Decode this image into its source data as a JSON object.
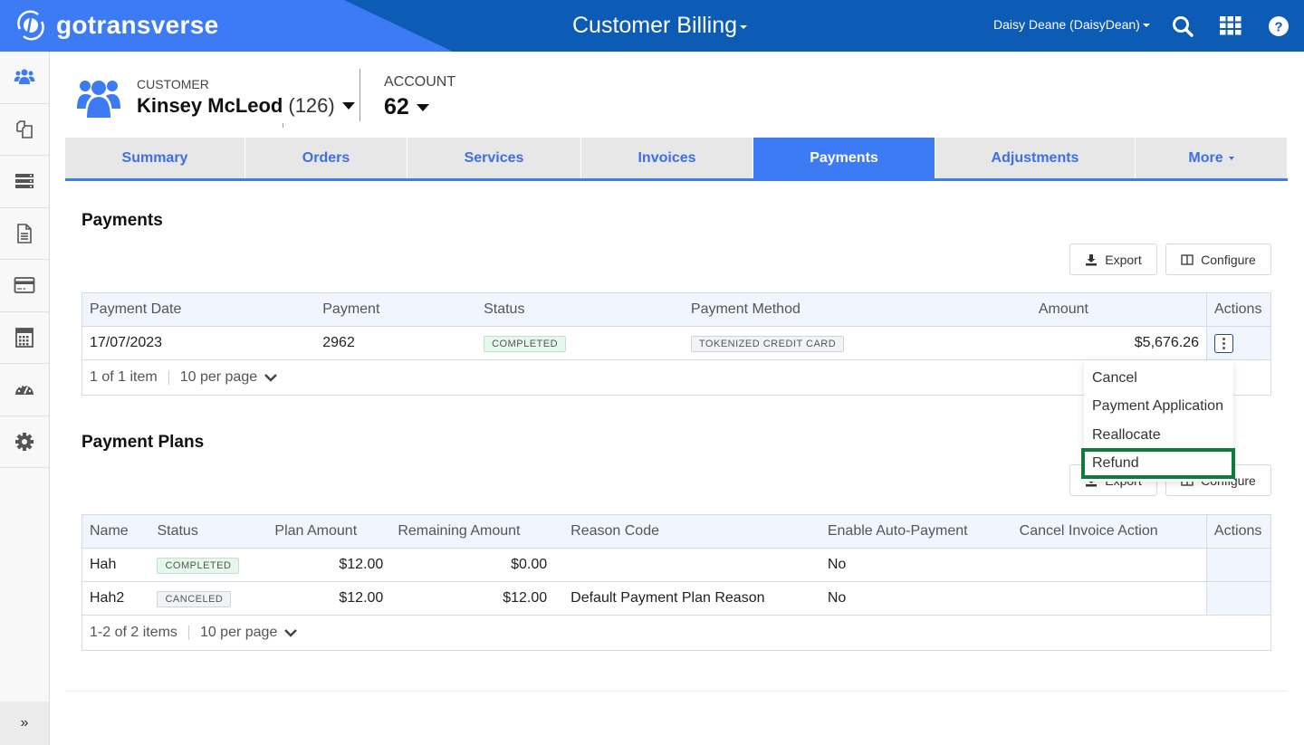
{
  "topbar": {
    "brand": "gotransverse",
    "app_title": "Customer Billing",
    "user": "Daisy Deane (DaisyDean)",
    "icons": [
      "search-icon",
      "apps-grid-icon",
      "help-icon"
    ]
  },
  "sidebar": {
    "items": [
      {
        "name": "customers",
        "icon": "users-icon",
        "active": true
      },
      {
        "name": "orders",
        "icon": "copy-icon"
      },
      {
        "name": "services",
        "icon": "server-icon"
      },
      {
        "name": "invoices",
        "icon": "document-icon"
      },
      {
        "name": "payments",
        "icon": "credit-card-icon"
      },
      {
        "name": "calculator",
        "icon": "calculator-icon"
      },
      {
        "name": "dashboard",
        "icon": "gauge-icon"
      },
      {
        "name": "settings",
        "icon": "gear-icon"
      }
    ],
    "expand_label": "»"
  },
  "header": {
    "customer_label": "CUSTOMER",
    "customer_name": "Kinsey McLeod",
    "customer_id": "(126)",
    "account_label": "ACCOUNT",
    "account_number": "62"
  },
  "tabs": [
    {
      "label": "Summary"
    },
    {
      "label": "Orders"
    },
    {
      "label": "Services"
    },
    {
      "label": "Invoices"
    },
    {
      "label": "Payments",
      "active": true
    },
    {
      "label": "Adjustments"
    },
    {
      "label": "More"
    }
  ],
  "payments": {
    "title": "Payments",
    "export_label": "Export",
    "configure_label": "Configure",
    "columns": [
      "Payment Date",
      "Payment",
      "Status",
      "Payment Method",
      "Amount",
      "Actions"
    ],
    "rows": [
      {
        "date": "17/07/2023",
        "payment": "2962",
        "status": "COMPLETED",
        "method": "TOKENIZED CREDIT CARD",
        "amount": "$5,676.26"
      }
    ],
    "pager": {
      "summary": "1 of 1 item",
      "per_page": "10 per page"
    }
  },
  "actions_menu": {
    "items": [
      "Cancel",
      "Payment Application",
      "Reallocate",
      "Refund"
    ],
    "highlighted": "Refund"
  },
  "payment_plans": {
    "title": "Payment Plans",
    "export_label": "Export",
    "configure_label": "Configure",
    "columns": [
      "Name",
      "Status",
      "Plan Amount",
      "Remaining Amount",
      "Reason Code",
      "Enable Auto-Payment",
      "Cancel Invoice Action",
      "Actions"
    ],
    "rows": [
      {
        "name": "Hah",
        "status": "COMPLETED",
        "plan_amount": "$12.00",
        "remaining": "$0.00",
        "reason": "",
        "auto_pay": "No",
        "cancel_action": ""
      },
      {
        "name": "Hah2",
        "status": "CANCELED",
        "plan_amount": "$12.00",
        "remaining": "$12.00",
        "reason": "Default Payment Plan Reason",
        "auto_pay": "No",
        "cancel_action": ""
      }
    ],
    "pager": {
      "summary": "1-2 of 2 items",
      "per_page": "10 per page"
    }
  },
  "colors": {
    "brand_blue": "#3d7bf4",
    "topbar_dark": "#0c5bb5",
    "highlight_green": "#0f7a3c"
  }
}
